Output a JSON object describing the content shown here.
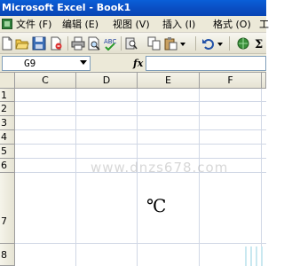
{
  "window": {
    "title": "Microsoft Excel - Book1"
  },
  "menu": {
    "items": [
      {
        "label": "文件 (F)"
      },
      {
        "label": "编辑 (E)"
      },
      {
        "label": "视图 (V)"
      },
      {
        "label": "插入 (I)"
      },
      {
        "label": "格式 (O)"
      },
      {
        "label": "工"
      }
    ]
  },
  "toolbar": {
    "icons": [
      "new-icon",
      "open-icon",
      "save-icon",
      "permission-icon",
      "print-icon",
      "print-preview-icon",
      "spelling-icon",
      "research-icon",
      "copy-icon",
      "paste-icon",
      "undo-icon",
      "hyperlink-icon",
      "autosum-icon"
    ]
  },
  "formula_bar": {
    "name_box": "G9",
    "fx_label": "fx",
    "formula": ""
  },
  "grid": {
    "columns": [
      "C",
      "D",
      "E",
      "F"
    ],
    "rows": [
      "1",
      "2",
      "3",
      "4",
      "5",
      "6",
      "7",
      "8"
    ],
    "cell_text": "℃",
    "watermark": "www.dnzs678.com"
  },
  "colors": {
    "titlebar": "#0a4fc4",
    "menubar": "#ece9d8",
    "gridline": "#d0d7e5"
  }
}
